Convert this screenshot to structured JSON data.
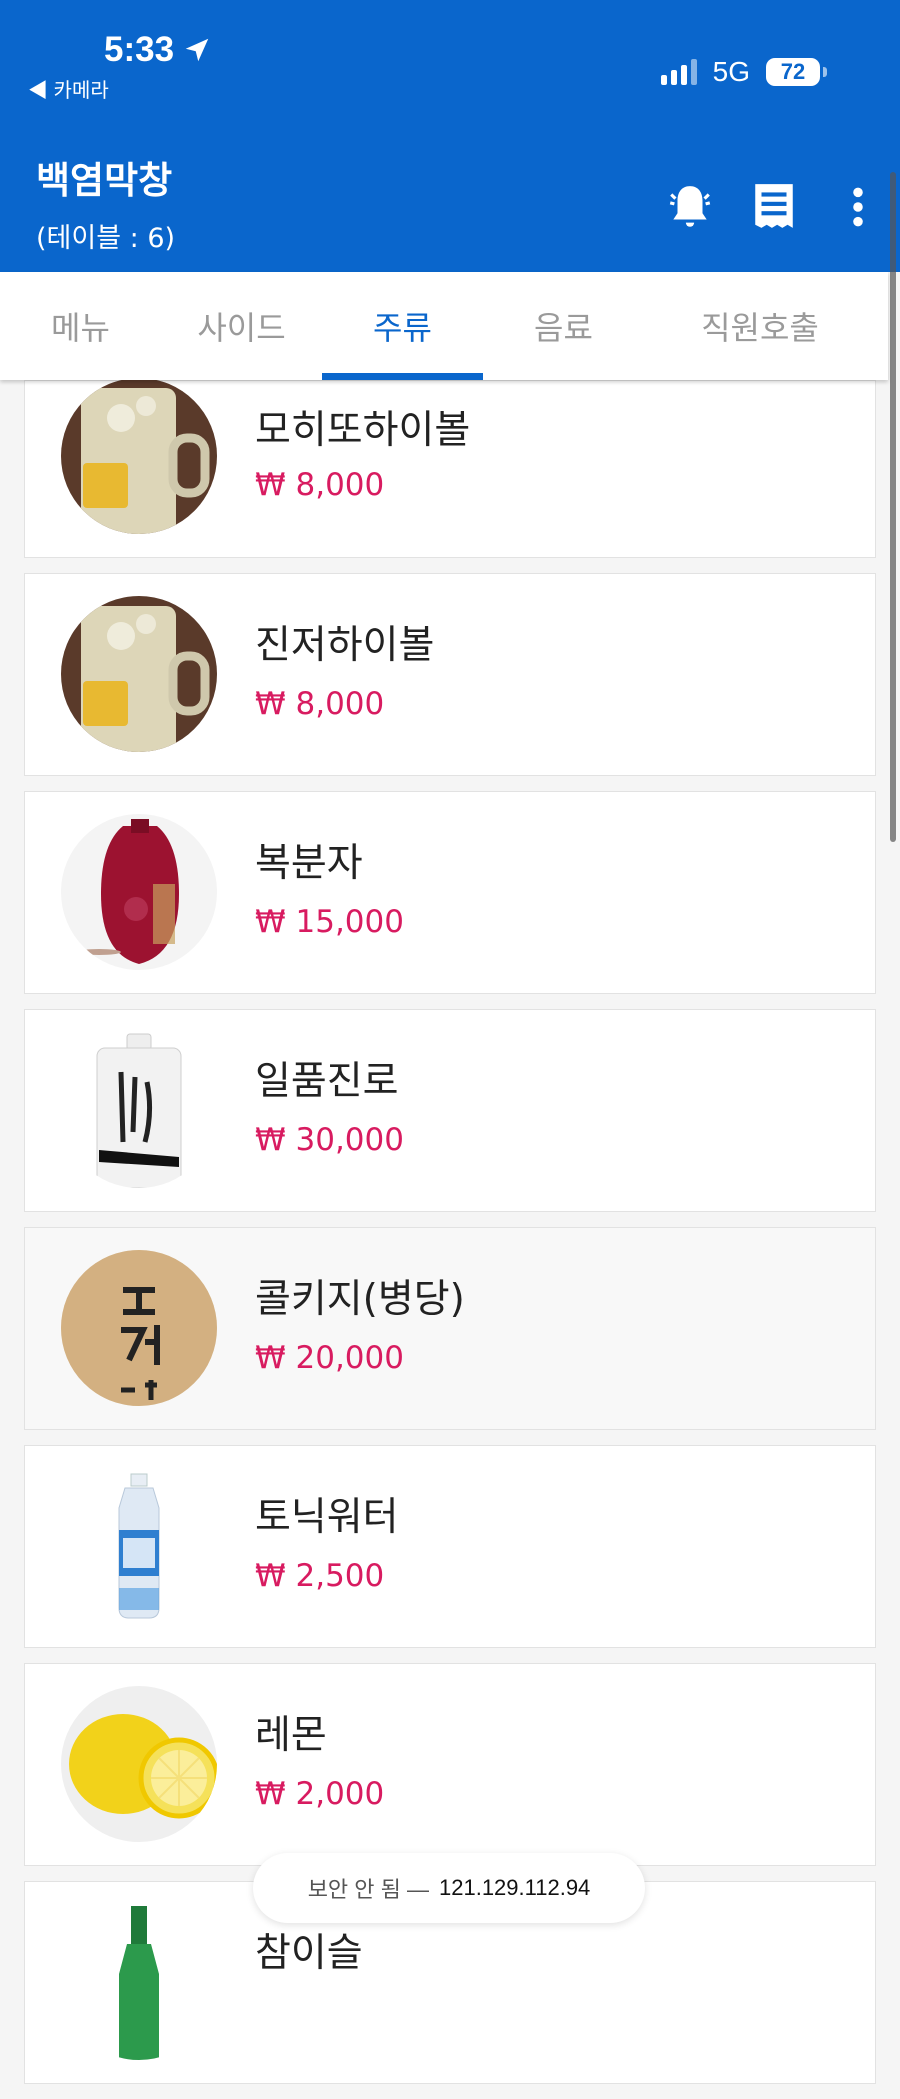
{
  "status_bar": {
    "time": "5:33",
    "back_label": "◀ 카메라",
    "network": "5G",
    "battery": "72"
  },
  "header": {
    "title": "백염막창",
    "subtitle": "(테이블 : 6)"
  },
  "tabs": [
    {
      "label": "메뉴"
    },
    {
      "label": "사이드"
    },
    {
      "label": "주류"
    },
    {
      "label": "음료"
    },
    {
      "label": "직원호출"
    }
  ],
  "active_tab": "주류",
  "items": [
    {
      "name": "모히또하이볼",
      "price": "₩ 8,000"
    },
    {
      "name": "진저하이볼",
      "price": "₩ 8,000"
    },
    {
      "name": "복분자",
      "price": "₩ 15,000"
    },
    {
      "name": "일품진로",
      "price": "₩ 30,000"
    },
    {
      "name": "콜키지(병당)",
      "price": "₩ 20,000"
    },
    {
      "name": "토닉워터",
      "price": "₩ 2,500"
    },
    {
      "name": "레몬",
      "price": "₩ 2,000"
    },
    {
      "name": "참이슬",
      "price": ""
    }
  ],
  "url_bar": {
    "insecure_label": "보안 안 됨 —",
    "host": "121.129.112.94"
  },
  "colors": {
    "primary": "#0a66cc",
    "price": "#d81b60"
  }
}
